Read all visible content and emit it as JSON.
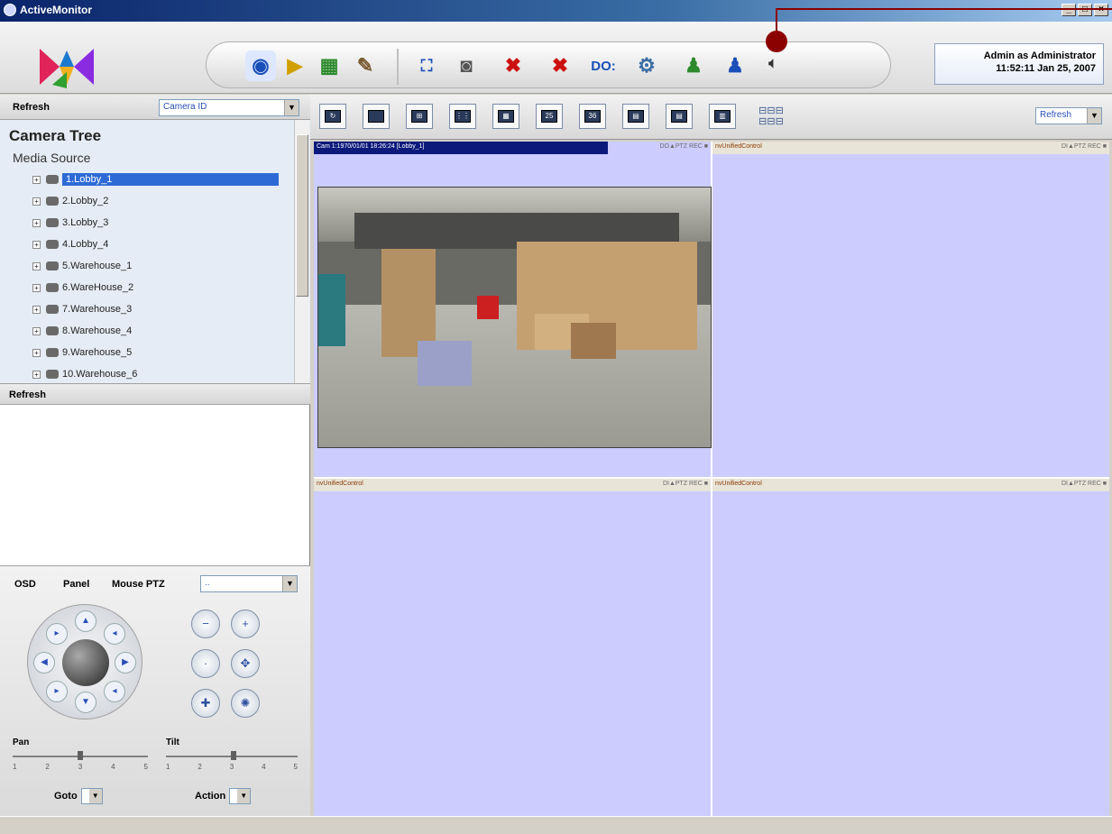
{
  "window": {
    "title": "ActiveMonitor"
  },
  "status": {
    "user": "Admin as Administrator",
    "datetime": "11:52:11 Jan 25, 2007"
  },
  "left": {
    "refresh_label": "Refresh",
    "camera_combo": "Camera ID",
    "tree_title": "Camera Tree",
    "media_source": "Media Source",
    "cameras": [
      "1.Lobby_1",
      "2.Lobby_2",
      "3.Lobby_3",
      "4.Lobby_4",
      "5.Warehouse_1",
      "6.WareHouse_2",
      "7.Warehouse_3",
      "8.Warehouse_4",
      "9.Warehouse_5",
      "10.Warehouse_6"
    ],
    "ptz_refresh": "Refresh"
  },
  "ptz": {
    "tabs": [
      "OSD",
      "Panel",
      "Mouse PTZ"
    ],
    "combo": "..",
    "pan_label": "Pan",
    "tilt_label": "Tilt",
    "ticks": [
      "1",
      "2",
      "3",
      "4",
      "5"
    ],
    "goto_label": "Goto",
    "action_label": "Action"
  },
  "video_toolbar": {
    "refresh": "Refresh",
    "layout_labels": [
      "25",
      "36"
    ]
  },
  "cells": [
    {
      "title": "Cam 1:1970/01/01 18:26:24 [Lobby_1]",
      "icons": "DO▲PTZ REC ■"
    },
    {
      "title": "nvUnifiedControl",
      "icons": "DI▲PTZ REC ■"
    },
    {
      "title": "nvUnifiedControl",
      "icons": "DI▲PTZ REC ■"
    },
    {
      "title": "nvUnifiedControl",
      "icons": "DI▲PTZ REC ■"
    }
  ],
  "colors": {
    "cell_bg": "#ccccff",
    "active_header": "#0c1a7c",
    "annotation": "#8b0000"
  }
}
